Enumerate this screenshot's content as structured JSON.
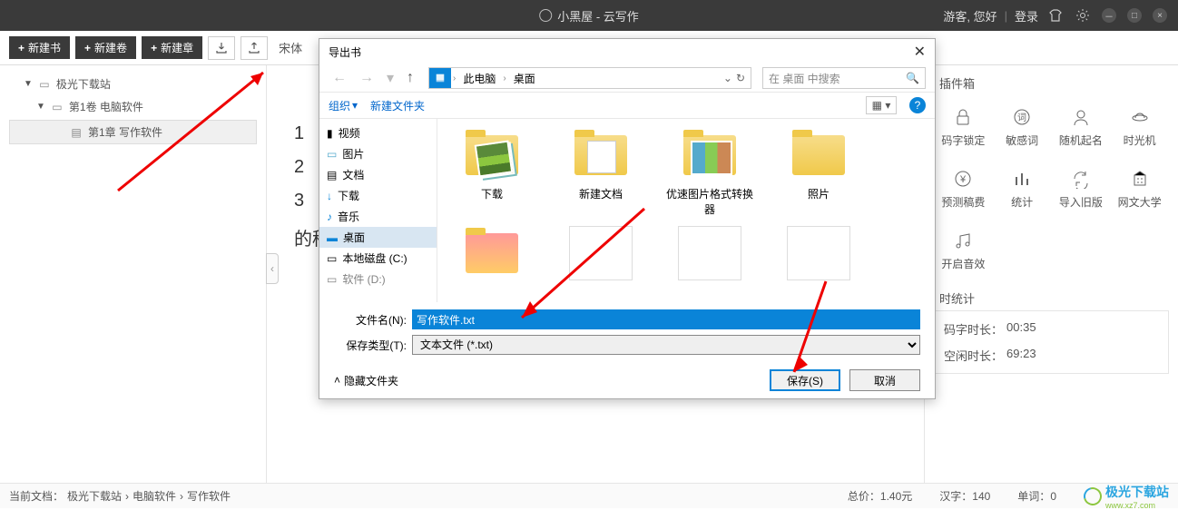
{
  "titlebar": {
    "app_title": "小黑屋 - 云写作",
    "guest": "游客, 您好",
    "login": "登录"
  },
  "toolbar": {
    "new_book": "新建书",
    "new_volume": "新建卷",
    "new_chapter": "新建章",
    "font_label": "宋体"
  },
  "tree": {
    "root": "极光下载站",
    "vol": "第1卷 电脑软件",
    "chap": "第1章 写作软件"
  },
  "editor": {
    "prefix": "的稿"
  },
  "tools": {
    "box_title": "插件箱",
    "items": [
      "码字锁定",
      "敏感词",
      "随机起名",
      "时光机",
      "预测稿费",
      "统计",
      "导入旧版",
      "网文大学",
      "开启音效"
    ]
  },
  "stats": {
    "title": "时统计",
    "row1_label": "码字时长：",
    "row1_val": "00:35",
    "row2_label": "空闲时长：",
    "row2_val": "69:23"
  },
  "dialog": {
    "title": "导出书",
    "path": {
      "pc": "此电脑",
      "desktop": "桌面"
    },
    "search_placeholder": "在 桌面 中搜索",
    "organize": "组织",
    "new_folder": "新建文件夹",
    "tree_items": [
      "视频",
      "图片",
      "文档",
      "下载",
      "音乐",
      "桌面",
      "本地磁盘 (C:)",
      "软件 (D:)"
    ],
    "folders": [
      "下载",
      "新建文档",
      "优速图片格式转换器",
      "照片"
    ],
    "filename_label": "文件名(N):",
    "filename_value": "写作软件.txt",
    "filetype_label": "保存类型(T):",
    "filetype_value": "文本文件 (*.txt)",
    "hide": "隐藏文件夹",
    "save": "保存(S)",
    "cancel": "取消"
  },
  "statusbar": {
    "current_doc": "当前文档：",
    "crumbs": [
      "极光下载站",
      "电脑软件",
      "写作软件"
    ],
    "words_label": "汉字：",
    "words_val": "140",
    "chars_label": "单词：",
    "chars_val": "0",
    "price_label": "总价：",
    "price_val": "1.40元",
    "logo": "极光下载站",
    "logo_sub": "www.xz7.com"
  }
}
